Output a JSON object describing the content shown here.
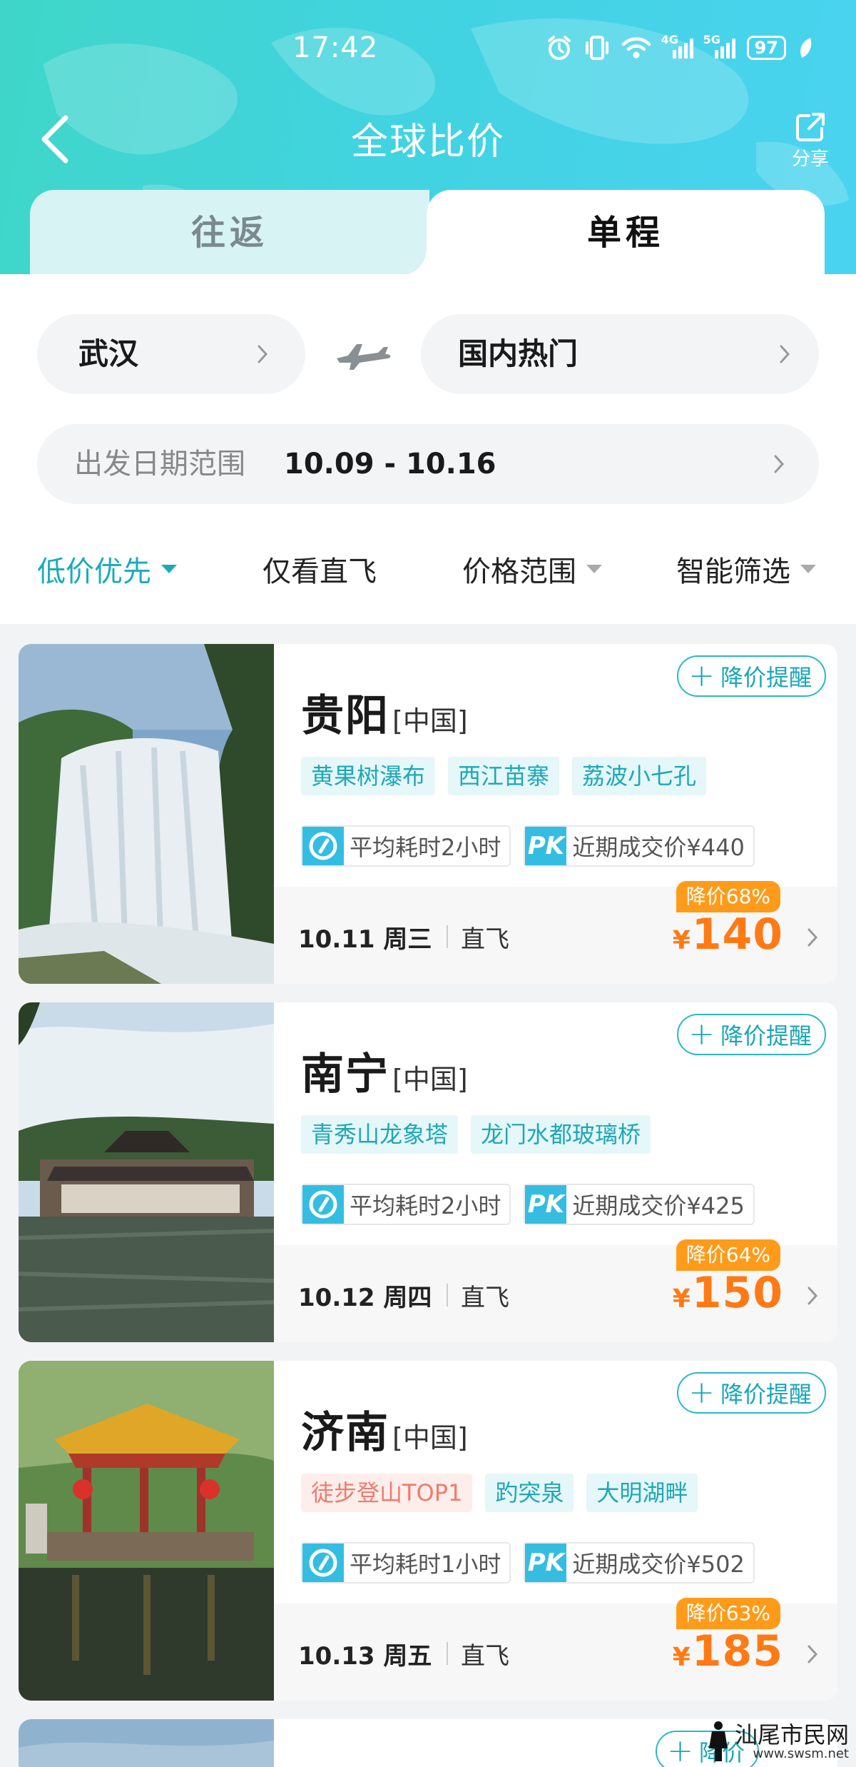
{
  "status": {
    "time": "17:42",
    "battery": "97",
    "net1": "4G",
    "net2": "5G"
  },
  "header": {
    "title": "全球比价",
    "share_label": "分享"
  },
  "tabs": {
    "round_trip": "往返",
    "one_way": "单程"
  },
  "search": {
    "from": "武汉",
    "to": "国内热门",
    "date_label": "出发日期范围",
    "date_value": "10.09 - 10.16"
  },
  "filters": {
    "sort": "低价优先",
    "direct": "仅看直飞",
    "price": "价格范围",
    "smart": "智能筛选"
  },
  "cards": [
    {
      "city": "贵阳",
      "country": "[中国]",
      "alert_label": "降价提醒",
      "tags": [
        {
          "text": "黄果树瀑布",
          "hot": false
        },
        {
          "text": "西江苗寨",
          "hot": false
        },
        {
          "text": "荔波小七孔",
          "hot": false
        }
      ],
      "avg_time": "平均耗时2小时",
      "pk_label": "PK",
      "recent_price": "近期成交价¥440",
      "date": "10.11 周三",
      "flight_type": "直飞",
      "discount": "降价68%",
      "currency": "¥",
      "price": "140"
    },
    {
      "city": "南宁",
      "country": "[中国]",
      "alert_label": "降价提醒",
      "tags": [
        {
          "text": "青秀山龙象塔",
          "hot": false
        },
        {
          "text": "龙门水都玻璃桥",
          "hot": false
        }
      ],
      "avg_time": "平均耗时2小时",
      "pk_label": "PK",
      "recent_price": "近期成交价¥425",
      "date": "10.12 周四",
      "flight_type": "直飞",
      "discount": "降价64%",
      "currency": "¥",
      "price": "150"
    },
    {
      "city": "济南",
      "country": "[中国]",
      "alert_label": "降价提醒",
      "tags": [
        {
          "text": "徒步登山TOP1",
          "hot": true
        },
        {
          "text": "趵突泉",
          "hot": false
        },
        {
          "text": "大明湖畔",
          "hot": false
        }
      ],
      "avg_time": "平均耗时1小时",
      "pk_label": "PK",
      "recent_price": "近期成交价¥502",
      "date": "10.13 周五",
      "flight_type": "直飞",
      "discount": "降价63%",
      "currency": "¥",
      "price": "185"
    }
  ],
  "partial_card": {
    "alert_label": "降价"
  },
  "watermark": {
    "text": "汕尾市民网",
    "url": "www.swsm.net"
  },
  "colors": {
    "accent": "#1aabbd",
    "price": "#ff7a14",
    "discount": "#ff9b1a",
    "header_start": "#3fd6c8",
    "header_end": "#4ad3f0"
  }
}
